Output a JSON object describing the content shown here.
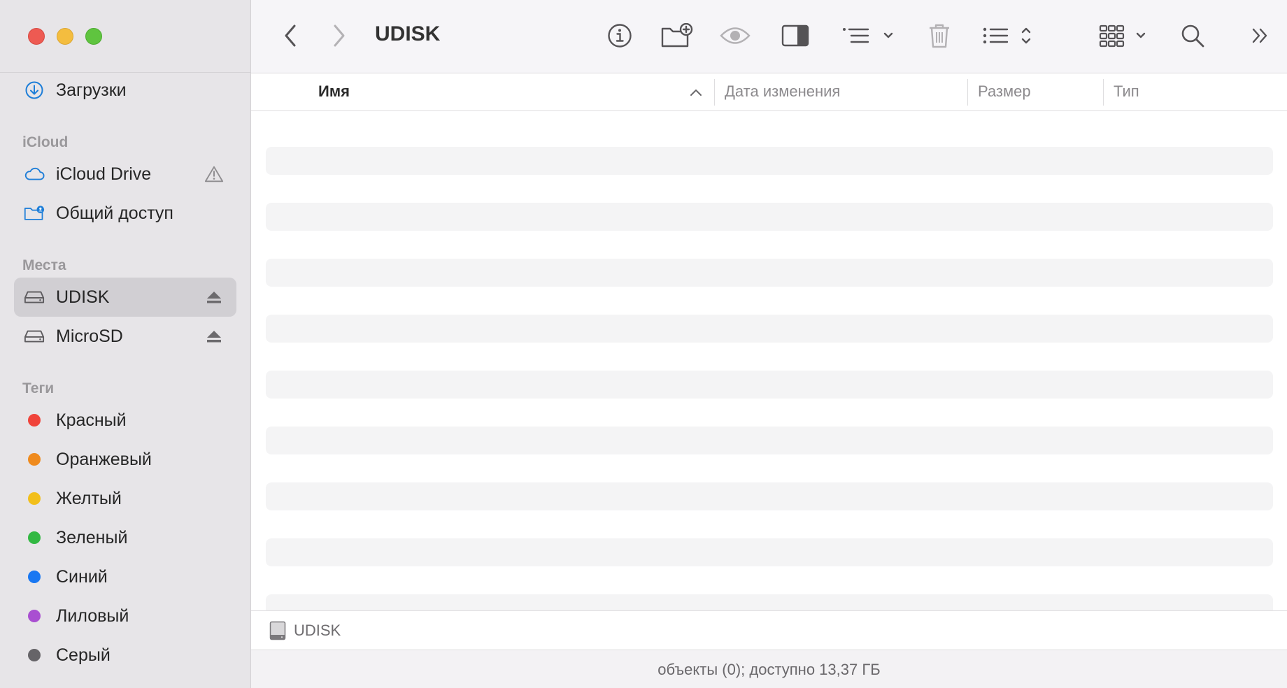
{
  "window": {
    "title": "UDISK"
  },
  "sidebar": {
    "top_item": {
      "label": "Загрузки",
      "icon": "download-icon"
    },
    "sections": [
      {
        "title": "iCloud",
        "items": [
          {
            "label": "iCloud Drive",
            "icon": "cloud-icon",
            "right_icon": "warning-icon"
          },
          {
            "label": "Общий доступ",
            "icon": "shared-folder-icon"
          }
        ]
      },
      {
        "title": "Места",
        "items": [
          {
            "label": "UDISK",
            "icon": "drive-icon",
            "right_icon": "eject-icon",
            "selected": true
          },
          {
            "label": "MicroSD",
            "icon": "drive-icon",
            "right_icon": "eject-icon"
          }
        ]
      },
      {
        "title": "Теги",
        "items": [
          {
            "label": "Красный",
            "color": "#f0433a"
          },
          {
            "label": "Оранжевый",
            "color": "#ef8a1d"
          },
          {
            "label": "Желтый",
            "color": "#f2bf1b"
          },
          {
            "label": "Зеленый",
            "color": "#32b842"
          },
          {
            "label": "Синий",
            "color": "#1877f2"
          },
          {
            "label": "Лиловый",
            "color": "#a94fd1"
          },
          {
            "label": "Серый",
            "color": "#666468"
          }
        ]
      }
    ]
  },
  "toolbar": {
    "back_icon": "chevron-left-icon",
    "forward_icon": "chevron-right-icon",
    "buttons": [
      "info-icon",
      "new-folder-icon",
      "quick-look-eye-icon",
      "preview-pane-icon",
      "group-by-icon",
      "trash-icon",
      "view-options-icon",
      "icon-view-icon",
      "search-icon",
      "more-chevrons-icon"
    ]
  },
  "columns": [
    {
      "label": "Имя",
      "active": true,
      "sort": "ascending"
    },
    {
      "label": "Дата изменения"
    },
    {
      "label": "Размер"
    },
    {
      "label": "Тип"
    }
  ],
  "pathbar": {
    "label": "UDISK",
    "icon": "disk-icon"
  },
  "status": {
    "text": "объекты (0); доступно 13,37 ГБ"
  },
  "colors": {
    "sidebar_bg": "#e7e5e8",
    "selected_bg": "#d1cfd3",
    "accent": "#1e7ed8",
    "stripe": "#f4f4f5"
  }
}
